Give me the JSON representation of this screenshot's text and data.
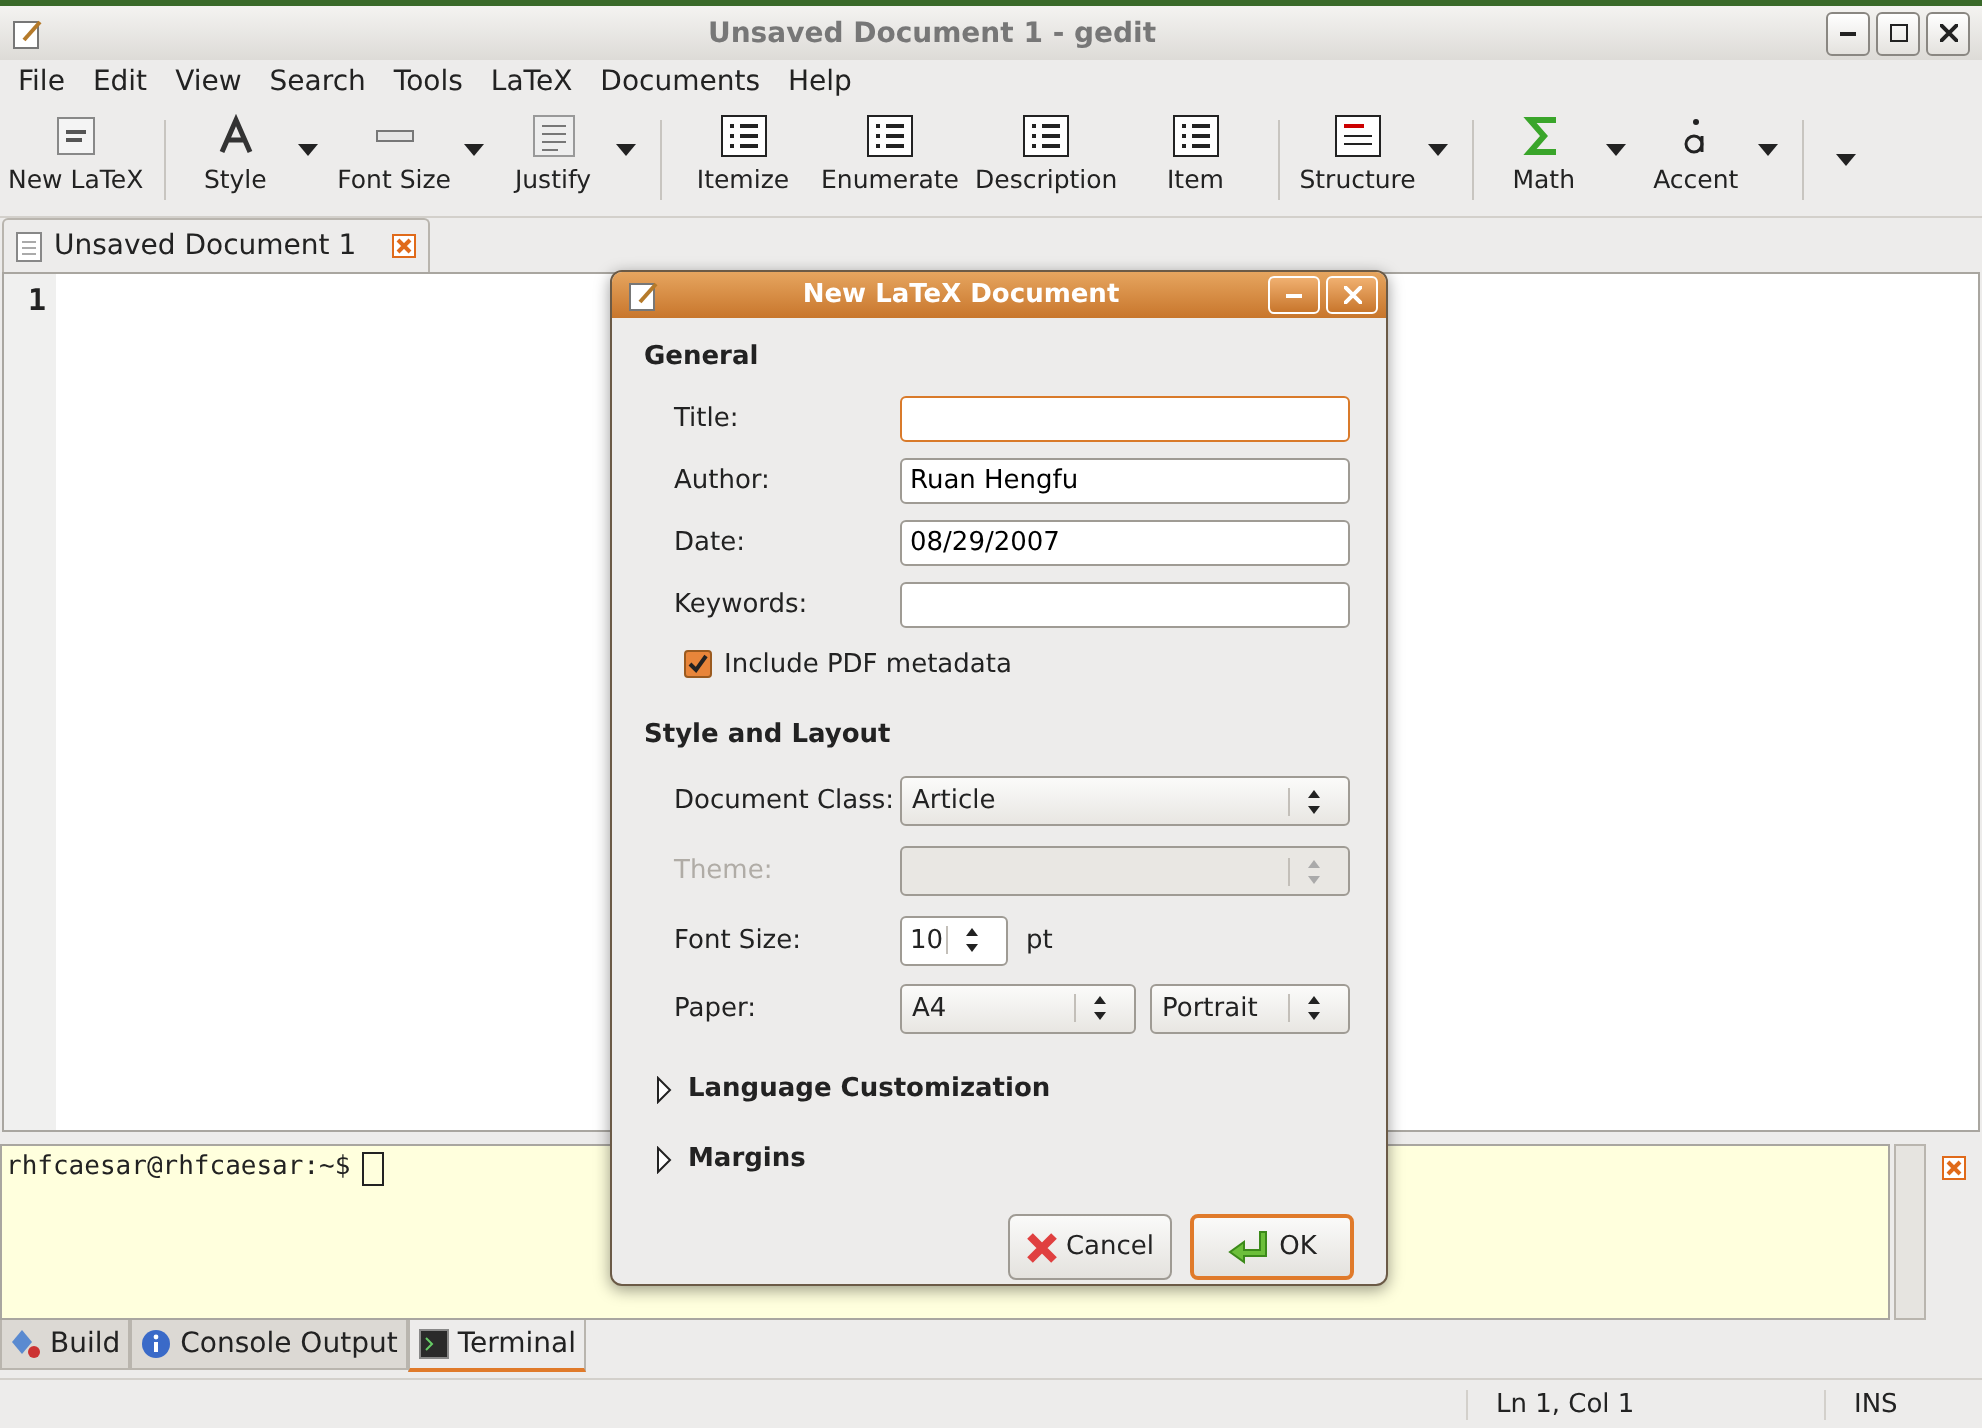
{
  "window": {
    "title": "Unsaved Document 1 - gedit"
  },
  "menu": [
    "File",
    "Edit",
    "View",
    "Search",
    "Tools",
    "LaTeX",
    "Documents",
    "Help"
  ],
  "toolbar": [
    {
      "kind": "button",
      "label": "New LaTeX",
      "has_menu": false
    },
    {
      "kind": "separator"
    },
    {
      "kind": "button",
      "label": "Style",
      "has_menu": true
    },
    {
      "kind": "button",
      "label": "Font Size",
      "has_menu": true
    },
    {
      "kind": "button",
      "label": "Justify",
      "has_menu": true
    },
    {
      "kind": "separator"
    },
    {
      "kind": "button",
      "label": "Itemize",
      "has_menu": false
    },
    {
      "kind": "button",
      "label": "Enumerate",
      "has_menu": false
    },
    {
      "kind": "button",
      "label": "Description",
      "has_menu": false
    },
    {
      "kind": "button",
      "label": "Item",
      "has_menu": false
    },
    {
      "kind": "separator"
    },
    {
      "kind": "button",
      "label": "Structure",
      "has_menu": true
    },
    {
      "kind": "separator"
    },
    {
      "kind": "button",
      "label": "Math",
      "has_menu": true
    },
    {
      "kind": "button",
      "label": "Accent",
      "has_menu": true
    },
    {
      "kind": "separator"
    },
    {
      "kind": "overflow"
    }
  ],
  "documents": [
    {
      "label": "Unsaved Document 1",
      "selected": true
    }
  ],
  "editor": {
    "line_numbers": [
      "1"
    ]
  },
  "dialog": {
    "title": "New LaTeX Document",
    "sections": [
      {
        "heading": "General",
        "rows": [
          {
            "kind": "text",
            "label": "Title:",
            "focused": true
          },
          {
            "kind": "text",
            "label": "Author:",
            "value": "Ruan Hengfu",
            "focused": false
          },
          {
            "kind": "text",
            "label": "Date:",
            "value": "08/29/2007",
            "focused": false
          },
          {
            "kind": "text",
            "label": "Keywords:",
            "focused": false
          },
          {
            "kind": "checkbox",
            "label": "Include PDF metadata",
            "checked": true
          }
        ]
      },
      {
        "heading": "Style and Layout",
        "rows": [
          {
            "kind": "combo",
            "label": "Document Class:",
            "value": "Article",
            "disabled": false
          },
          {
            "kind": "combo",
            "label": "Theme:",
            "disabled": true
          },
          {
            "kind": "spin",
            "label": "Font Size:",
            "value": "10",
            "unit": "pt"
          },
          {
            "kind": "pair",
            "label": "Paper:",
            "values": [
              "A4",
              "Portrait"
            ]
          }
        ]
      }
    ],
    "expanders": [
      {
        "label": "Language Customization",
        "expanded": false
      },
      {
        "label": "Margins",
        "expanded": false
      }
    ],
    "buttons": [
      {
        "kind": "cancel",
        "label": "Cancel",
        "default": false
      },
      {
        "kind": "ok",
        "label": "OK",
        "default": true
      }
    ]
  },
  "terminal": {
    "prompt": "rhfcaesar@rhfcaesar:~$"
  },
  "bottom_tabs": [
    {
      "kind": "build",
      "label": "Build",
      "selected": false
    },
    {
      "kind": "info",
      "label": "Console Output",
      "selected": false
    },
    {
      "kind": "terminal",
      "label": "Terminal",
      "selected": true
    }
  ],
  "status_bar": {
    "position": "Ln 1, Col 1",
    "mode": "INS"
  }
}
